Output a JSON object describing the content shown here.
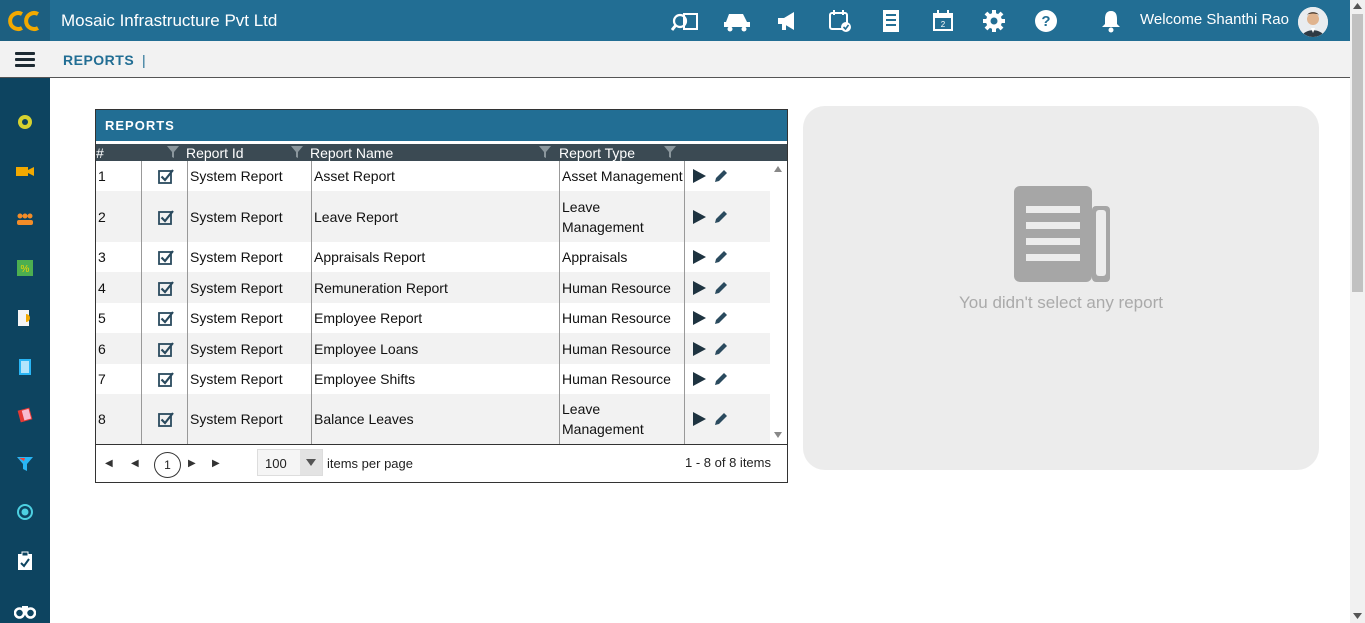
{
  "header": {
    "app_title": "Mosaic Infrastructure Pvt Ltd",
    "welcome_text": "Welcome Shanthi Rao",
    "icons": [
      "search-report-icon",
      "vehicle-icon",
      "megaphone-icon",
      "calendar-check-icon",
      "document-list-icon",
      "calendar-icon",
      "gear-icon",
      "help-icon",
      "bell-icon"
    ]
  },
  "subbar": {
    "breadcrumb": "REPORTS",
    "separator": "|"
  },
  "sidebar": {
    "icons": [
      "dashboard-icon",
      "video-icon",
      "users-icon",
      "finance-icon",
      "document-icon",
      "book-icon",
      "eraser-icon",
      "filter-icon",
      "target-icon",
      "clipboard-icon",
      "binoculars-icon"
    ]
  },
  "panel": {
    "title": "REPORTS",
    "columns": {
      "num": "#",
      "report_id": "Report Id",
      "report_name": "Report Name",
      "report_type": "Report Type"
    },
    "rows": [
      {
        "num": "1",
        "id": "System Report",
        "name": "Asset Report",
        "type": "Asset Management"
      },
      {
        "num": "2",
        "id": "System Report",
        "name": "Leave Report",
        "type": "Leave Management"
      },
      {
        "num": "3",
        "id": "System Report",
        "name": "Appraisals Report",
        "type": "Appraisals"
      },
      {
        "num": "4",
        "id": "System Report",
        "name": "Remuneration Report",
        "type": "Human Resource"
      },
      {
        "num": "5",
        "id": "System Report",
        "name": "Employee Report",
        "type": "Human Resource"
      },
      {
        "num": "6",
        "id": "System Report",
        "name": "Employee Loans",
        "type": "Human Resource"
      },
      {
        "num": "7",
        "id": "System Report",
        "name": "Employee Shifts",
        "type": "Human Resource"
      },
      {
        "num": "8",
        "id": "System Report",
        "name": "Balance Leaves",
        "type": "Leave Management"
      }
    ],
    "pager": {
      "current_page": "1",
      "page_size": "100",
      "items_per_page_label": "items per page",
      "info": "1 - 8 of 8 items"
    }
  },
  "preview": {
    "message": "You didn't select any report"
  },
  "colors": {
    "primary": "#226e94",
    "sidebar": "#0d4460",
    "grid_header": "#3b4a53"
  }
}
